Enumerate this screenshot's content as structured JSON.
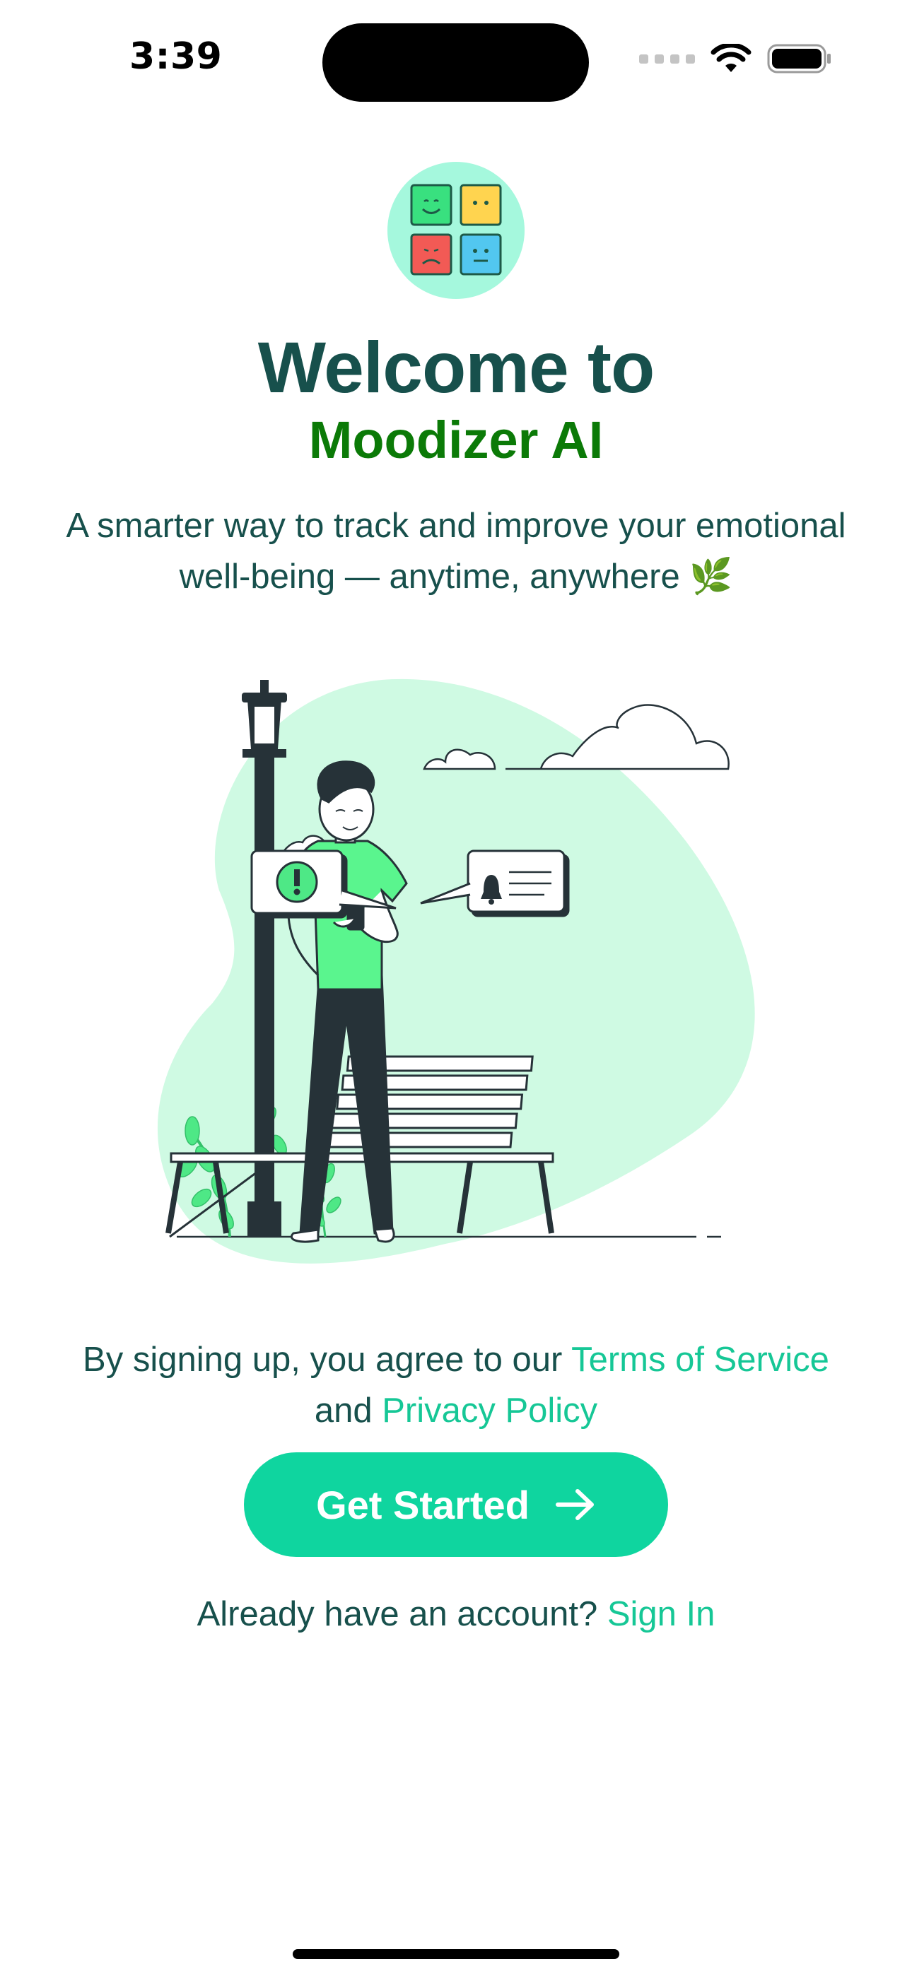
{
  "status_bar": {
    "time": "3:39",
    "icons": [
      "cellular-signal-icon",
      "wifi-icon",
      "battery-icon"
    ]
  },
  "logo": {
    "icon": "mood-grid-icon",
    "moods": [
      "happy",
      "neutral",
      "sad",
      "calm"
    ],
    "colors": [
      "#39e07f",
      "#ffd44f",
      "#f25a55",
      "#52c7f0"
    ]
  },
  "welcome": {
    "line1": "Welcome to",
    "app_name": "Moodizer AI",
    "subtitle_line1": "A smarter way to track and improve your emotional",
    "subtitle_line2": "well-being — anytime, anywhere 🌿"
  },
  "illustration": {
    "icon": "person-with-phone-on-park-bench-illustration"
  },
  "legal": {
    "prefix": "By signing up, you agree to our ",
    "terms_link": "Terms of Service",
    "middle": "and ",
    "privacy_link": "Privacy Policy"
  },
  "cta": {
    "label": "Get Started",
    "icon": "arrow-right-icon"
  },
  "signin": {
    "prompt": "Already have an account? ",
    "link": "Sign In"
  },
  "colors": {
    "primary": "#0fd59f",
    "heading": "#17504c",
    "brand_green": "#0b7a07",
    "link": "#16c796",
    "logo_bg": "#a5f8dd"
  }
}
